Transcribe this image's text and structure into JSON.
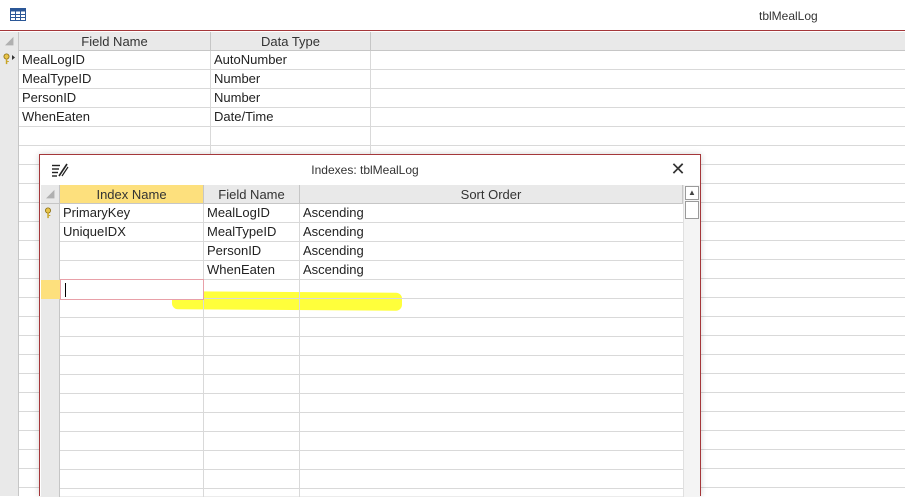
{
  "window": {
    "title": "tblMealLog",
    "icon": "table-icon"
  },
  "design_grid": {
    "headers": [
      "Field Name",
      "Data Type"
    ],
    "rows": [
      {
        "field": "MealLogID",
        "type": "AutoNumber",
        "primary_key": true
      },
      {
        "field": "MealTypeID",
        "type": "Number"
      },
      {
        "field": "PersonID",
        "type": "Number"
      },
      {
        "field": "WhenEaten",
        "type": "Date/Time"
      }
    ]
  },
  "indexes_dialog": {
    "title": "Indexes: tblMealLog",
    "icon": "indexes-icon",
    "close_icon": "close-icon",
    "headers": [
      "Index Name",
      "Field Name",
      "Sort Order"
    ],
    "rows": [
      {
        "index": "PrimaryKey",
        "field": "MealLogID",
        "sort": "Ascending",
        "primary_key": true
      },
      {
        "index": "UniqueIDX",
        "field": "MealTypeID",
        "sort": "Ascending"
      },
      {
        "index": "",
        "field": "PersonID",
        "sort": "Ascending"
      },
      {
        "index": "",
        "field": "WhenEaten",
        "sort": "Ascending",
        "highlighted": true
      }
    ],
    "current_row_value": ""
  },
  "colors": {
    "accent": "#a4373a",
    "active_header": "#fde07d",
    "highlight": "#ffff3b",
    "header_bg": "#e9e9e9"
  }
}
